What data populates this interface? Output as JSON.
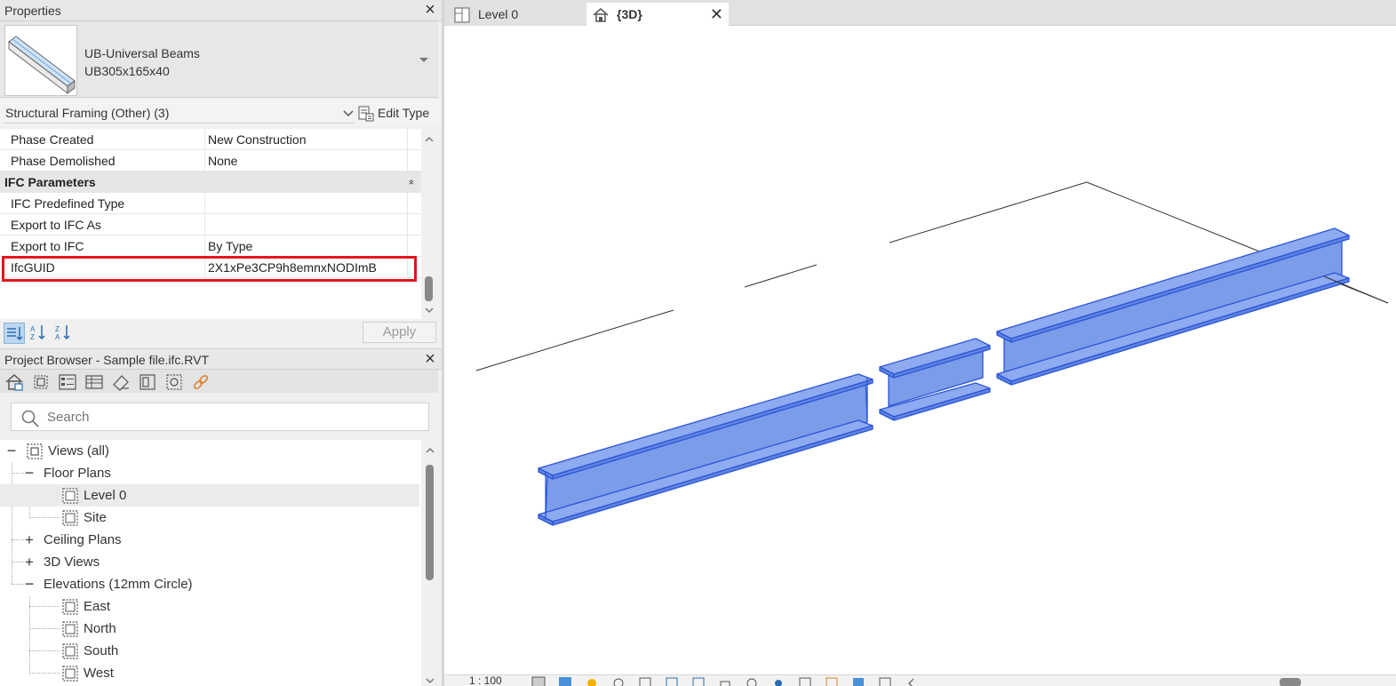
{
  "properties": {
    "title": "Properties",
    "type_family": "UB-Universal Beams",
    "type_size": "UB305x165x40",
    "category": "Structural Framing (Other) (3)",
    "edit_type": "Edit Type",
    "rows": [
      {
        "key": "Phase Created",
        "value": "New Construction"
      },
      {
        "key": "Phase Demolished",
        "value": "None"
      }
    ],
    "group_ifc": "IFC Parameters",
    "group_collapse": "»",
    "ifc_rows": [
      {
        "key": "IFC Predefined Type",
        "value": ""
      },
      {
        "key": "Export to IFC As",
        "value": ""
      },
      {
        "key": "Export to IFC",
        "value": "By Type"
      },
      {
        "key": "IfcGUID",
        "value": "2X1xPe3CP9h8emnxNODImB"
      }
    ],
    "apply": "Apply"
  },
  "browser": {
    "title": "Project Browser - Sample file.ifc.RVT",
    "search_placeholder": "Search",
    "tree": {
      "views_all": "Views (all)",
      "floor_plans": "Floor Plans",
      "level0": "Level 0",
      "site": "Site",
      "ceiling_plans": "Ceiling Plans",
      "views3d": "3D Views",
      "elevations": "Elevations (12mm Circle)",
      "east": "East",
      "north": "North",
      "south": "South",
      "west": "West"
    }
  },
  "tabs": {
    "level0": "Level 0",
    "view3d": "{3D}"
  },
  "status": {
    "scale": "1 : 100"
  },
  "colors": {
    "beam_fill": "#7b9ce8",
    "beam_edge": "#2a55d8",
    "highlight": "#e3141c"
  }
}
